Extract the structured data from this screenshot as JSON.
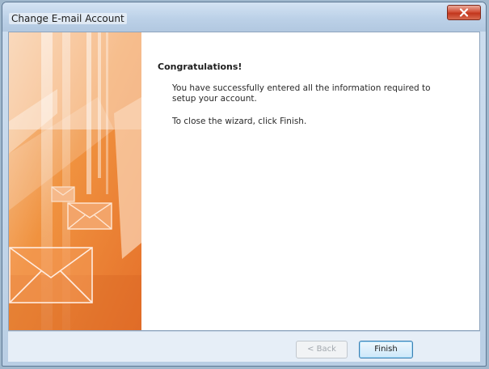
{
  "window": {
    "title": "Change E-mail Account"
  },
  "wizard": {
    "heading": "Congratulations!",
    "message": "You have successfully entered all the information required to setup your account.",
    "instruction": "To close the wizard, click Finish."
  },
  "buttons": {
    "back_label": "< Back",
    "finish_label": "Finish"
  },
  "icons": {
    "close": "close-icon",
    "banner_envelopes": "envelope-icon"
  },
  "colors": {
    "banner_orange": "#ef8a3b",
    "banner_light": "#f7c9a1",
    "close_red": "#c2361d",
    "finish_border": "#3c7fb1"
  }
}
